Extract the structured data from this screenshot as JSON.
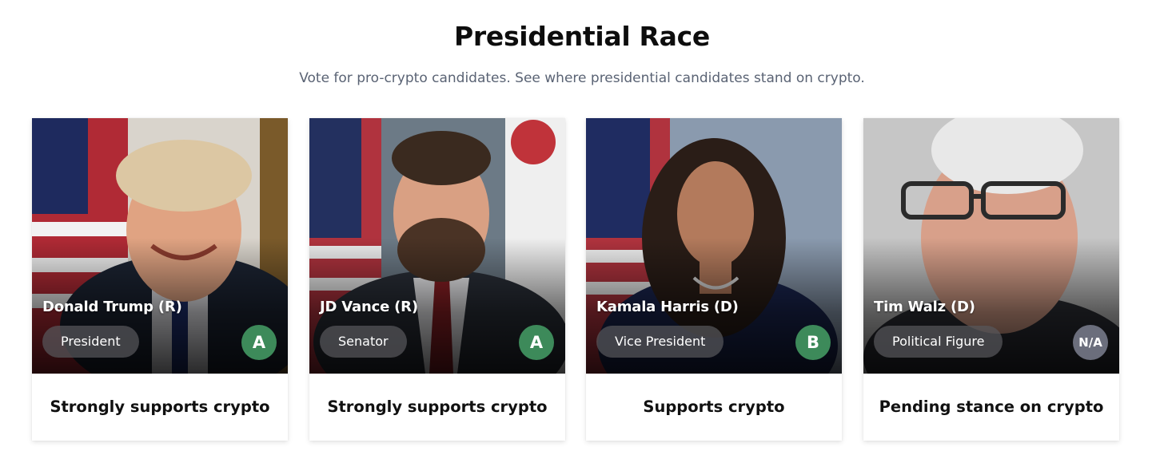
{
  "header": {
    "title": "Presidential Race",
    "subtitle": "Vote for pro-crypto candidates. See where presidential candidates stand on crypto."
  },
  "grade_colors": {
    "A": "#3d8a5a",
    "B": "#3d8a5a",
    "N/A": "#6b6e7c"
  },
  "candidates": [
    {
      "name": "Donald Trump (R)",
      "role": "President",
      "grade": "A",
      "stance": "Strongly supports crypto",
      "photo_icon": "portrait-photo"
    },
    {
      "name": "JD Vance (R)",
      "role": "Senator",
      "grade": "A",
      "stance": "Strongly supports crypto",
      "photo_icon": "portrait-photo"
    },
    {
      "name": "Kamala Harris (D)",
      "role": "Vice President",
      "grade": "B",
      "stance": "Supports crypto",
      "photo_icon": "portrait-photo"
    },
    {
      "name": "Tim Walz (D)",
      "role": "Political Figure",
      "grade": "N/A",
      "stance": "Pending stance on crypto",
      "photo_icon": "portrait-photo"
    }
  ]
}
